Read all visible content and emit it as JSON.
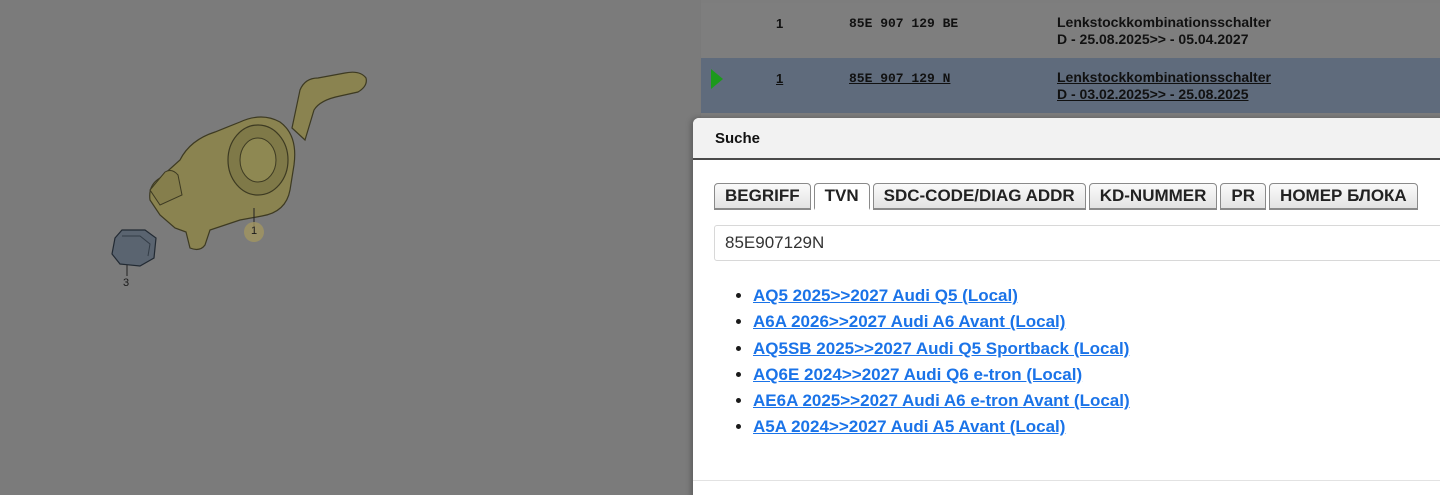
{
  "diagram": {
    "callouts": [
      "1",
      "3"
    ]
  },
  "parts": [
    {
      "pos": "1",
      "part_no": "85E 907 129 BE",
      "name": "Lenkstockkombinationsschalter",
      "validity": "D - 25.08.2025>> - 05.04.2027",
      "selected": false
    },
    {
      "pos": "1",
      "part_no": "85E 907 129 N",
      "name": "Lenkstockkombinationsschalter",
      "validity": "D - 03.02.2025>> - 25.08.2025",
      "selected": true
    }
  ],
  "dialog": {
    "title": "Suche",
    "tabs": [
      {
        "label": "BEGRIFF",
        "active": false
      },
      {
        "label": "TVN",
        "active": true
      },
      {
        "label": "SDC-CODE/DIAG ADDR",
        "active": false
      },
      {
        "label": "KD-NUMMER",
        "active": false
      },
      {
        "label": "PR",
        "active": false
      },
      {
        "label": "НОМЕР БЛОКА",
        "active": false
      }
    ],
    "search_value": "85E907129N",
    "results": [
      "AQ5 2025>>2027 Audi Q5 (Local)",
      "A6A 2026>>2027 Audi A6 Avant (Local)",
      "AQ5SB 2025>>2027 Audi Q5 Sportback (Local)",
      "AQ6E 2024>>2027 Audi Q6 e-tron (Local)",
      "AE6A 2025>>2027 Audi A6 e-tron Avant (Local)",
      "A5A 2024>>2027 Audi A5 Avant (Local)"
    ]
  },
  "colors": {
    "overlay": "#7a7a7a",
    "selected_row": "#5f6b7c",
    "marker": "#1c9a1c",
    "link": "#1a73e8",
    "part_fill": "#8a8350"
  }
}
